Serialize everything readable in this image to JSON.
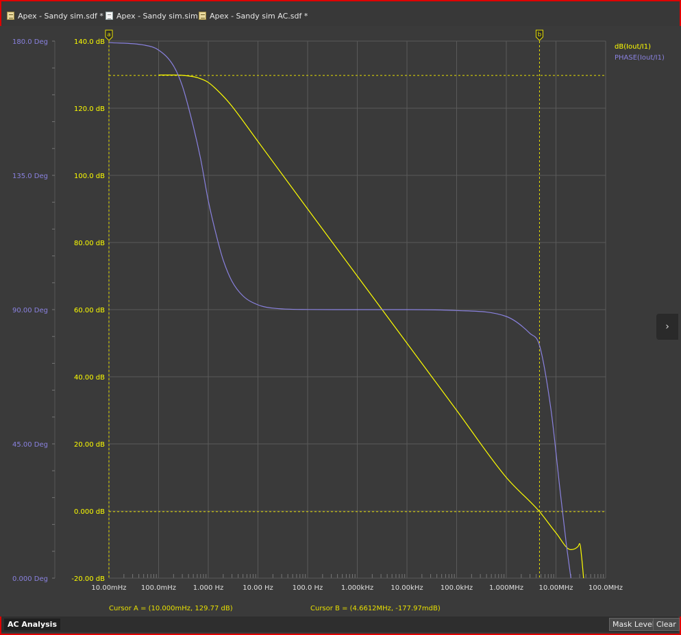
{
  "tabs": [
    {
      "label": "Apex - Sandy sim.sdf *",
      "icon": "waveform-doc-icon"
    },
    {
      "label": "Apex - Sandy sim.sim",
      "icon": "document-icon"
    },
    {
      "label": "Apex - Sandy sim AC.sdf *",
      "icon": "waveform-doc-icon"
    }
  ],
  "chart_data": {
    "type": "line",
    "x_scale": "log",
    "x_range_hz": [
      0.01,
      100000000
    ],
    "x_tick_labels": [
      "10.00mHz",
      "100.0mHz",
      "1.000 Hz",
      "10.00 Hz",
      "100.0 Hz",
      "1.000kHz",
      "10.00kHz",
      "100.0kHz",
      "1.000MHz",
      "10.00MHz",
      "100.0MHz"
    ],
    "y_left_label_axis": {
      "range": [
        0,
        180
      ],
      "unit": "Deg",
      "tick_labels": [
        "180.0 Deg",
        "135.0 Deg",
        "90.00 Deg",
        "45.00 Deg",
        "0.000 Deg"
      ]
    },
    "y_db_axis": {
      "range": [
        -20,
        140
      ],
      "unit": "dB",
      "tick_labels": [
        "140.0 dB",
        "120.0 dB",
        "100.0 dB",
        "80.00 dB",
        "60.00 dB",
        "40.00 dB",
        "20.00 dB",
        "0.000 dB",
        "-20.00 dB"
      ]
    },
    "series": [
      {
        "name": "dB(Iout/I1)",
        "color": "#ffff00",
        "axis": "dB",
        "x": [
          0.1,
          0.2,
          0.3,
          0.5,
          0.7,
          1,
          2,
          3,
          10,
          100,
          1000,
          10000,
          100000,
          1000000,
          4661200,
          10000000,
          20000000,
          28000000,
          30000000,
          33000000,
          36000000
        ],
        "y": [
          129.9,
          129.9,
          129.8,
          129.4,
          128.8,
          127.7,
          123.6,
          120.6,
          110.1,
          90.0,
          70.0,
          50.0,
          30.0,
          10.0,
          -0.18,
          -6.5,
          -11.5,
          -10.5,
          -9.7,
          -14.0,
          -20.0
        ]
      },
      {
        "name": "PHASE(Iout/I1)",
        "color": "#8a82e0",
        "axis": "Deg",
        "x": [
          0.01,
          0.05,
          0.1,
          0.2,
          0.3,
          0.5,
          0.7,
          1,
          1.5,
          2,
          3,
          5,
          10,
          20,
          100,
          1000,
          10000,
          100000,
          1000000,
          3000000,
          4661200,
          8000000,
          12000000,
          16000000,
          20000000
        ],
        "y": [
          179.5,
          178.7,
          177.0,
          171.7,
          165.0,
          151.4,
          140.6,
          126.5,
          114.0,
          106.6,
          99.5,
          94.6,
          91.6,
          90.5,
          90.05,
          90.0,
          90.0,
          89.7,
          87.7,
          82.0,
          78.0,
          56.0,
          30.0,
          12.0,
          0
        ]
      }
    ],
    "legend": "top-right",
    "grid": true,
    "cursors": [
      {
        "name": "a",
        "x": 0.01
      },
      {
        "name": "b",
        "x": 4661200
      }
    ],
    "cursor_levels_db": [
      129.77,
      -0.17797
    ]
  },
  "legend": {
    "series1": "dB(Iout/I1)",
    "series2": "PHASE(Iout/I1)"
  },
  "cursor_readouts": {
    "a": "Cursor A = (10.000mHz, 129.77 dB)",
    "b": "Cursor B = (4.6612MHz, -177.97mdB)"
  },
  "status": {
    "tab": "AC Analysis",
    "mask_button": "Mask Level",
    "clear_button": "Clear"
  },
  "side_arrow": "›",
  "colors": {
    "db": "#ffff00",
    "phase": "#8a82e0",
    "grid": "#5a5a5a",
    "cursor": "#e8e000"
  }
}
